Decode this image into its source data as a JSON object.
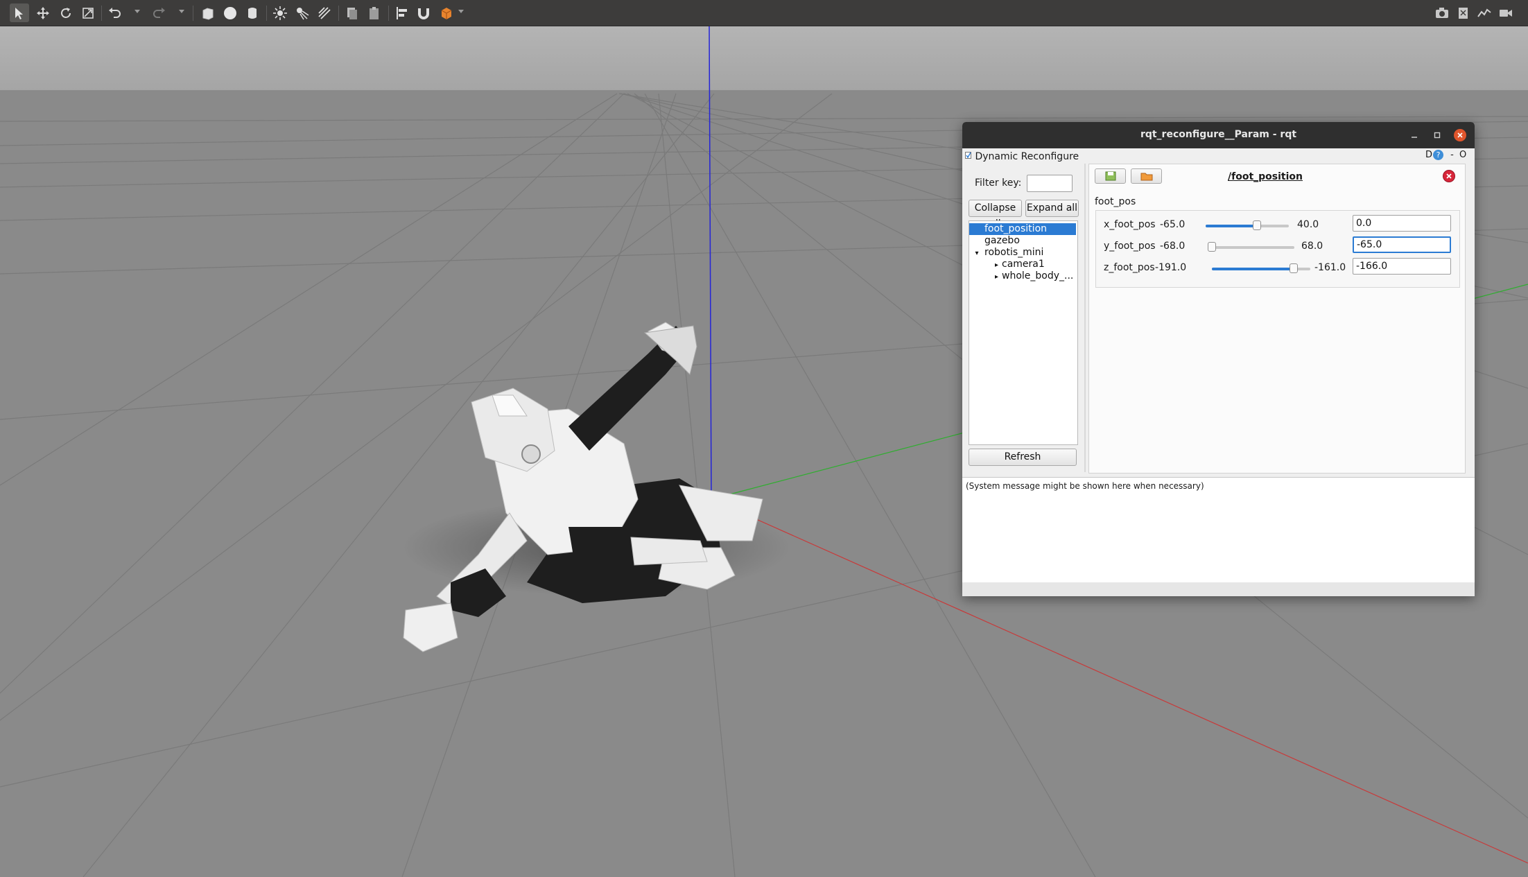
{
  "toolbar": {
    "left_tools": [
      "select-icon",
      "translate-icon",
      "rotate-icon",
      "scale-icon",
      "undo-icon",
      "redo-icon",
      "box-icon",
      "sphere-icon",
      "cylinder-icon",
      "point-light-icon",
      "spot-light-icon",
      "directional-light-icon",
      "copy-icon",
      "paste-icon",
      "align-icon",
      "snap-icon",
      "view-angle-icon"
    ],
    "right_tools": [
      "screenshot-icon",
      "log-icon",
      "plot-icon",
      "record-icon"
    ]
  },
  "rqt": {
    "title": "rqt_reconfigure__Param - rqt",
    "plugin_label": "Dynamic Reconfigure",
    "plugin_ctrl_d": "D",
    "plugin_ctrl_help": "?",
    "plugin_ctrl_min": "-",
    "plugin_ctrl_close": "O",
    "filter_label": "Filter key:",
    "filter_value": "",
    "collapse_all": "Collapse all",
    "expand_all": "Expand all",
    "tree": [
      {
        "label": "foot_position",
        "selected": true,
        "depth": 0,
        "arrow": ""
      },
      {
        "label": "gazebo",
        "selected": false,
        "depth": 0,
        "arrow": ""
      },
      {
        "label": "robotis_mini",
        "selected": false,
        "depth": 0,
        "arrow": "▾"
      },
      {
        "label": "camera1",
        "selected": false,
        "depth": 1,
        "arrow": "▸"
      },
      {
        "label": "whole_body_...",
        "selected": false,
        "depth": 1,
        "arrow": "▸"
      }
    ],
    "refresh": "Refresh",
    "node_title": "/foot_position",
    "group_label": "foot_pos",
    "params": [
      {
        "name": "x_foot_pos",
        "min": "-65.0",
        "max": "40.0",
        "value": "0.0",
        "fraction": 0.62
      },
      {
        "name": "y_foot_pos",
        "min": "-68.0",
        "max": "68.0",
        "value": "-65.0",
        "fraction": 0.01
      },
      {
        "name": "z_foot_pos",
        "min": "-191.0",
        "max": "-161.0",
        "value": "-166.0",
        "fraction": 0.833
      }
    ],
    "system_message": "(System message might be shown here when necessary)"
  }
}
